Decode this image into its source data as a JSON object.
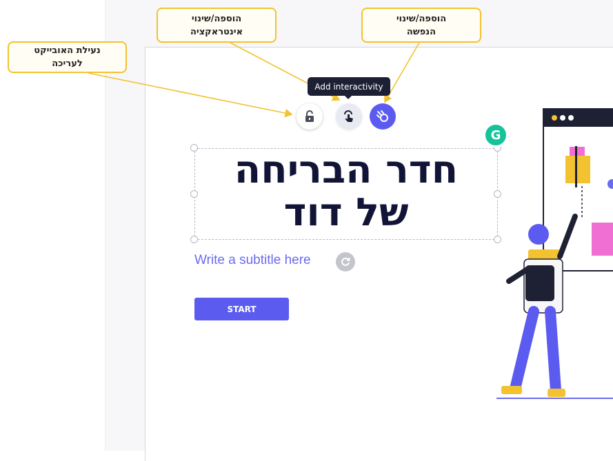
{
  "callouts": {
    "lock": "נעילת האובייקט\nלעריכה",
    "interactivity": "הוספה/שינוי\nאינטראקציה",
    "animation": "הוספה/שינוי\nהנפשה"
  },
  "toolbar": {
    "tooltip": "Add interactivity",
    "lock_icon": "lock-icon",
    "interactivity_icon": "touch-icon",
    "animation_icon": "animation-icon"
  },
  "slide": {
    "title": "חדר הבריחה\nשל דוד",
    "subtitle": "Write a subtitle here",
    "start_button": "START"
  },
  "colors": {
    "accent": "#5b5bf0",
    "callout_border": "#f2c230",
    "title": "#111436",
    "tooltip_bg": "#1d2035"
  }
}
